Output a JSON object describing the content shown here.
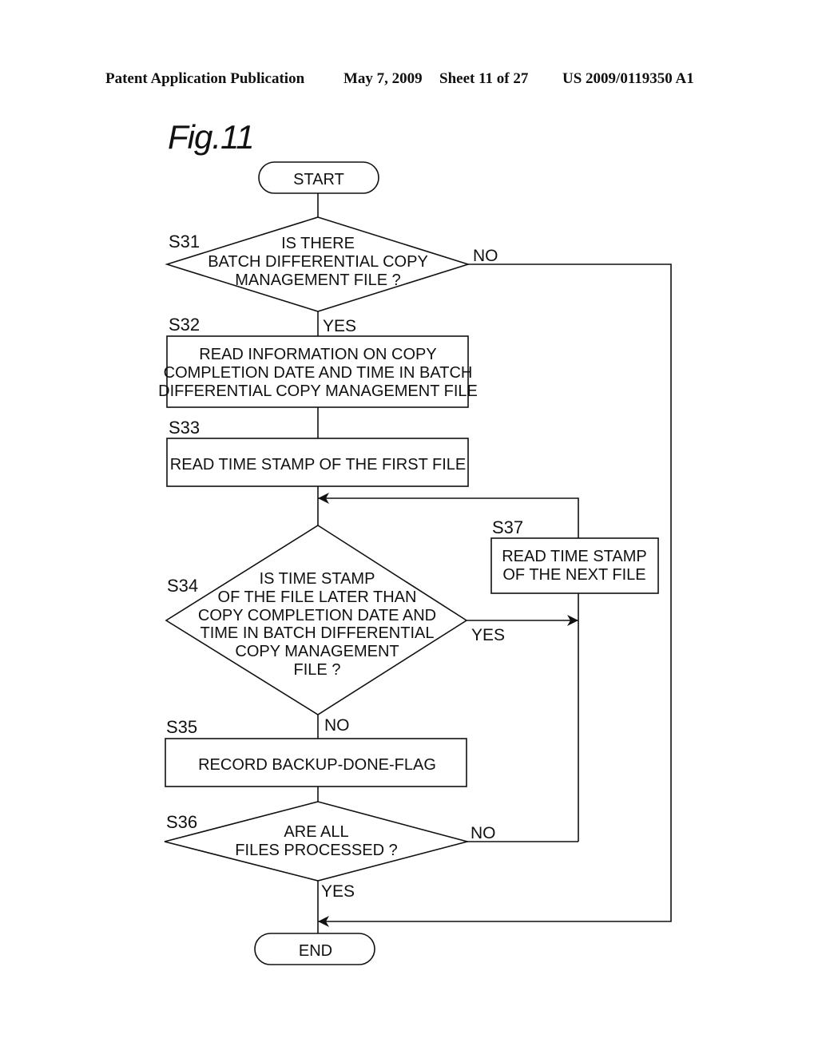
{
  "header": {
    "publication": "Patent Application Publication",
    "date": "May 7, 2009",
    "sheet": "Sheet 11 of 27",
    "number": "US 2009/0119350 A1"
  },
  "figure": {
    "title": "Fig.11"
  },
  "nodes": {
    "start": {
      "type": "terminal",
      "label": "START"
    },
    "s31": {
      "type": "decision",
      "step": "S31",
      "lines": [
        "IS THERE",
        "BATCH DIFFERENTIAL COPY",
        "MANAGEMENT FILE ?"
      ]
    },
    "s32": {
      "type": "process",
      "step": "S32",
      "lines": [
        "READ INFORMATION ON COPY",
        "COMPLETION DATE AND TIME IN BATCH",
        "DIFFERENTIAL COPY MANAGEMENT FILE"
      ]
    },
    "s33": {
      "type": "process",
      "step": "S33",
      "lines": [
        "READ TIME STAMP OF THE FIRST FILE"
      ]
    },
    "s34": {
      "type": "decision",
      "step": "S34",
      "lines": [
        "IS TIME STAMP",
        "OF THE FILE LATER THAN",
        "COPY COMPLETION DATE AND",
        "TIME IN BATCH DIFFERENTIAL",
        "COPY MANAGEMENT",
        "FILE ?"
      ]
    },
    "s35": {
      "type": "process",
      "step": "S35",
      "lines": [
        "RECORD BACKUP-DONE-FLAG"
      ]
    },
    "s36": {
      "type": "decision",
      "step": "S36",
      "lines": [
        "ARE ALL",
        "FILES PROCESSED ?"
      ]
    },
    "s37": {
      "type": "process",
      "step": "S37",
      "lines": [
        "READ TIME STAMP",
        "OF THE NEXT FILE"
      ]
    },
    "end": {
      "type": "terminal",
      "label": "END"
    }
  },
  "edges": {
    "start_s31": {
      "from": "start",
      "to": "s31",
      "label": ""
    },
    "s31_yes": {
      "from": "s31",
      "to": "s32",
      "label": "YES"
    },
    "s31_no": {
      "from": "s31",
      "to": "end",
      "label": "NO"
    },
    "s32_s33": {
      "from": "s32",
      "to": "s33",
      "label": ""
    },
    "s33_s34": {
      "from": "s33",
      "to": "s34",
      "label": ""
    },
    "s34_yes": {
      "from": "s34",
      "to": "s37",
      "label": "YES"
    },
    "s34_no": {
      "from": "s34",
      "to": "s35",
      "label": "NO"
    },
    "s35_s36": {
      "from": "s35",
      "to": "s36",
      "label": ""
    },
    "s36_no": {
      "from": "s36",
      "to": "s37",
      "label": "NO"
    },
    "s36_yes": {
      "from": "s36",
      "to": "end",
      "label": "YES"
    },
    "s37_loop": {
      "from": "s37",
      "to": "s34",
      "label": ""
    }
  }
}
